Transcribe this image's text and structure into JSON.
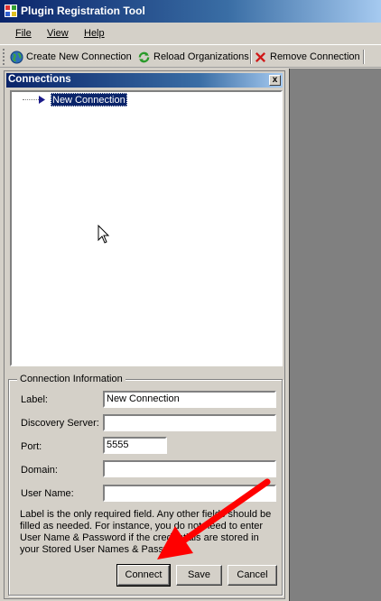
{
  "window": {
    "title": "Plugin Registration Tool"
  },
  "menu": {
    "file": "File",
    "view": "View",
    "help": "Help"
  },
  "toolbar": {
    "create": "Create New Connection",
    "reload": "Reload Organizations",
    "remove": "Remove Connection"
  },
  "connections": {
    "title": "Connections",
    "close": "x",
    "tree": [
      {
        "label": "New Connection",
        "selected": true
      }
    ]
  },
  "info": {
    "legend": "Connection Information",
    "label_label": "Label:",
    "label_value": "New Connection",
    "discovery_label": "Discovery Server:",
    "discovery_value": "",
    "port_label": "Port:",
    "port_value": "5555",
    "domain_label": "Domain:",
    "domain_value": "",
    "user_label": "User Name:",
    "user_value": "",
    "note": "Label is the only required field. Any other fields should be filled as needed. For instance, you do not need to enter User Name & Password if the credentials are stored in your Stored User Names & Passwords."
  },
  "buttons": {
    "connect": "Connect",
    "save": "Save",
    "cancel": "Cancel"
  },
  "colors": {
    "titlebar": "#0a246a",
    "arrow": "#ff0000",
    "selection": "#0a246a"
  }
}
